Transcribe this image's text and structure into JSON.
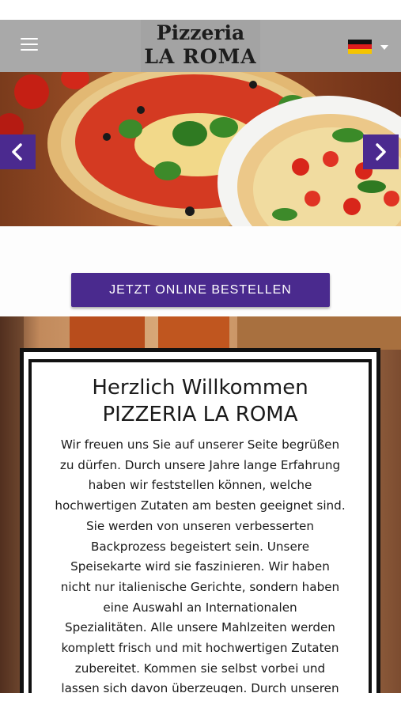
{
  "header": {
    "logo_line1": "Pizzeria",
    "logo_line2": "LA ROMA",
    "language_flag": "german-flag",
    "colors": {
      "header_bg": "#a9a9a9",
      "accent": "#4a2a8e"
    }
  },
  "slider": {
    "prev_icon": "chevron-left-icon",
    "next_icon": "chevron-right-icon"
  },
  "order_button": {
    "label": "JETZT ONLINE BESTELLEN"
  },
  "welcome": {
    "title_line1": "Herzlich Willkommen",
    "title_line2": "PIZZERIA LA ROMA",
    "body_lines": [
      "Wir freuen uns Sie auf unserer Seite begrüßen",
      "zu dürfen. Durch unsere Jahre lange Erfahrung",
      "haben wir feststellen können, welche",
      "hochwertigen Zutaten am besten geeignet sind.",
      "Sie werden von unseren verbesserten",
      "Backprozess begeistert sein. Unsere",
      "Speisekarte wird sie faszinieren. Wir haben",
      "nicht nur italienische Gerichte, sondern haben",
      "eine Auswahl an Internationalen",
      "Spezialitäten. Alle unsere Mahlzeiten werden",
      "komplett frisch und mit hochwertigen Zutaten",
      "zubereitet. Kommen sie selbst vorbei und",
      "lassen sich davon überzeugen. Durch unseren"
    ]
  }
}
